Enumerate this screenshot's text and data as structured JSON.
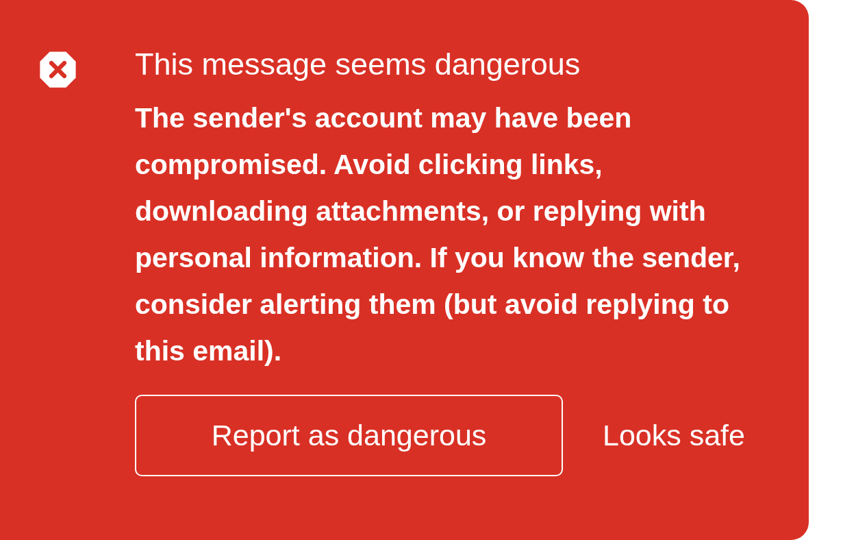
{
  "alert": {
    "title": "This message seems dangerous",
    "message": "The sender's account may have been compromised. Avoid clicking links, downloading attachments, or replying with personal information. If you know the sender, consider alerting them (but avoid replying to this email).",
    "actions": [
      {
        "kind": "outlined",
        "label": "Report as dangerous"
      },
      {
        "kind": "text",
        "label": "Looks safe"
      }
    ]
  }
}
